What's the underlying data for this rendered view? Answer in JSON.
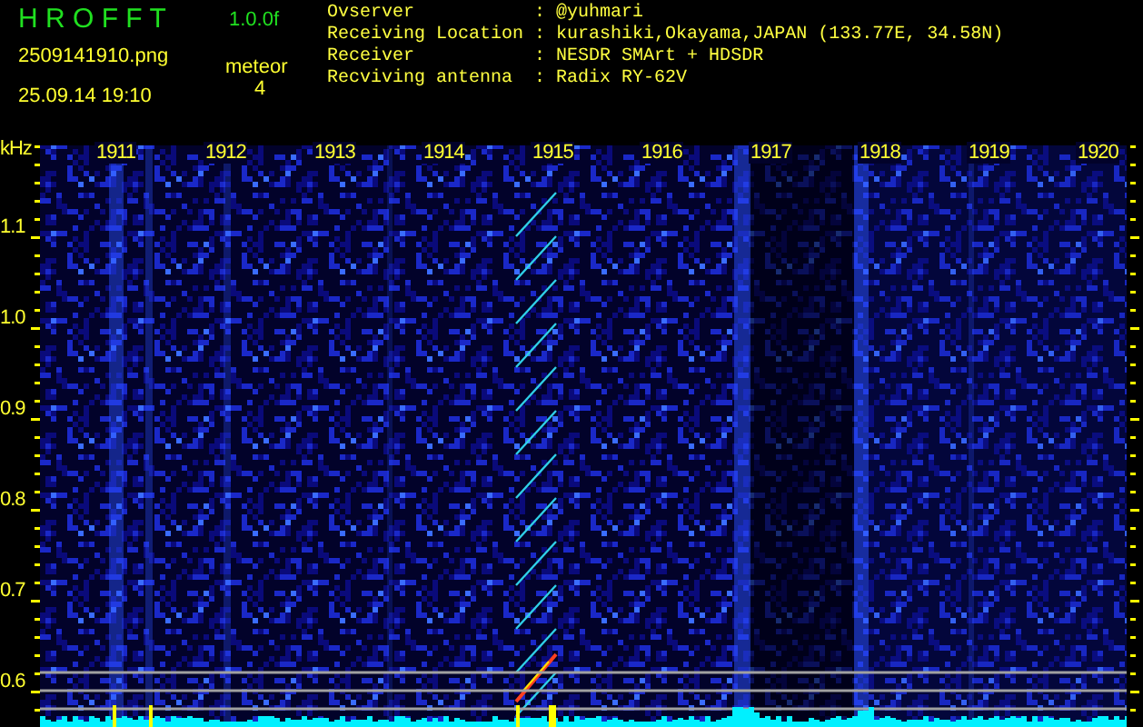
{
  "header": {
    "title": "H R O F F T",
    "version": "1.0.0f",
    "filename": "2509141910.png",
    "timestamp": "25.09.14 19:10",
    "detection_label": "meteor",
    "detection_count": "4"
  },
  "info": [
    {
      "label": "Ovserver",
      "separator": ":",
      "value": "@yuhmari"
    },
    {
      "label": "Receiving Location",
      "separator": ":",
      "value": "kurashiki,Okayama,JAPAN (133.77E, 34.58N)"
    },
    {
      "label": "Receiver",
      "separator": ":",
      "value": "NESDR SMArt + HDSDR"
    },
    {
      "label": "Recviving antenna",
      "separator": ":",
      "value": "Radix RY-62V"
    }
  ],
  "spectrogram": {
    "frequency_unit": "kHz",
    "frequency_labels": [
      "1.1",
      "1.0",
      "0.9",
      "0.8",
      "0.7",
      "0.6"
    ],
    "time_labels": [
      "1911",
      "1912",
      "1913",
      "1914",
      "1915",
      "1916",
      "1917",
      "1918",
      "1919",
      "1920"
    ]
  }
}
